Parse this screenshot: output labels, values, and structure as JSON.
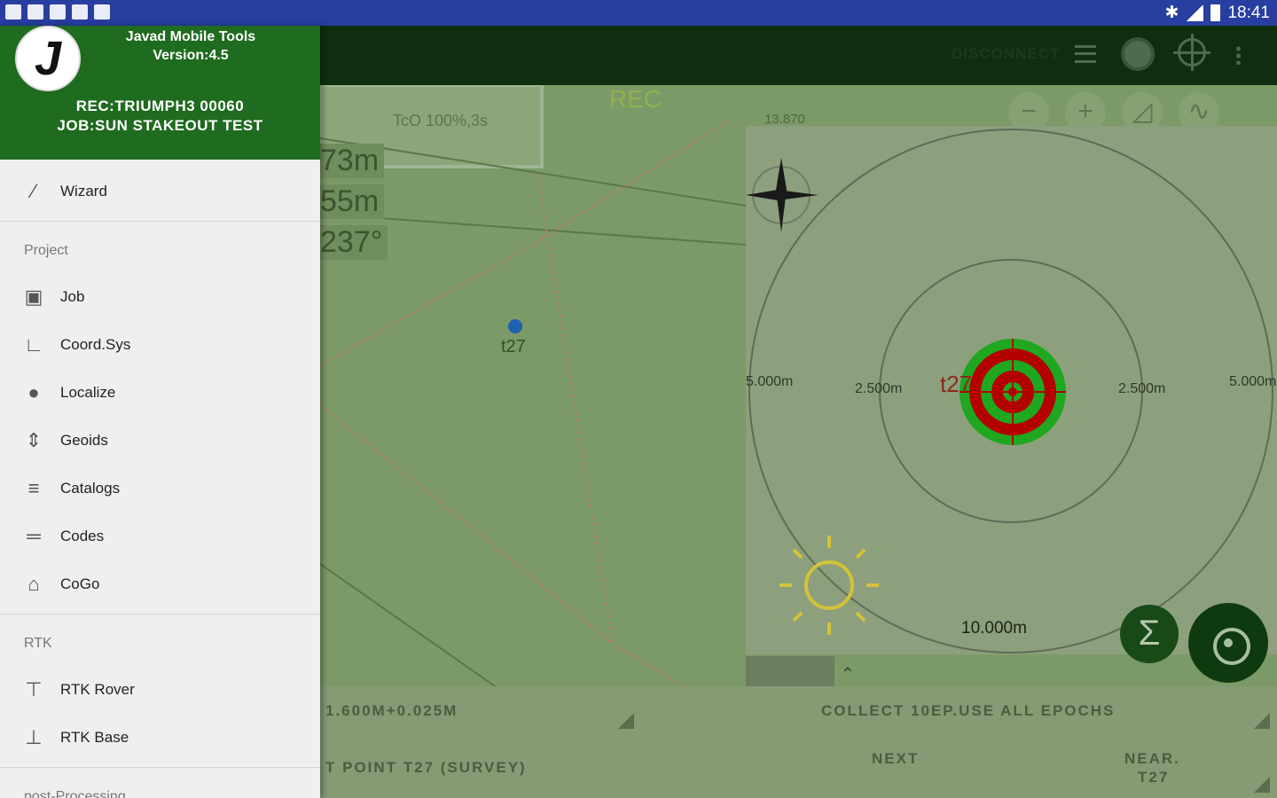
{
  "statusbar": {
    "time": "18:41"
  },
  "toolbar": {
    "disconnect_label": "DISCONNECT"
  },
  "drawer": {
    "app_name": "Javad Mobile Tools",
    "version": "Version:4.5",
    "receiver": "REC:TRIUMPH3 00060",
    "job": "JOB:SUN STAKEOUT TEST",
    "logo_text": "J",
    "wizard": "Wizard",
    "sections": {
      "project": "Project",
      "rtk": "RTK",
      "post": "post-Processing"
    },
    "project_items": [
      "Job",
      "Coord.Sys",
      "Localize",
      "Geoids",
      "Catalogs",
      "Codes",
      "CoGo"
    ],
    "rtk_items": [
      "RTK Rover",
      "RTK Base"
    ]
  },
  "map": {
    "gnss": "TcO 100%,3s",
    "rec": "REC",
    "coord": "13.870",
    "dist1": "73m",
    "dist2": "55m",
    "angle": "237°",
    "point": "t27"
  },
  "bullseye": {
    "ring_outer_left": "5.000m",
    "ring_inner_left": "2.500m",
    "ring_inner_right": "2.500m",
    "ring_outer_right": "5.000m",
    "scale": "10.000m",
    "point_label": "t27"
  },
  "bottom": {
    "height": "1.600M+0.025M",
    "collect": "COLLECT 10EP.USE ALL EPOCHS",
    "stake_point": "T POINT  T27 (SURVEY)",
    "next": "NEXT",
    "near_1": "NEAR.",
    "near_2": "T27"
  },
  "colors": {
    "statusbar": "#283ea0",
    "drawer_header": "#1f6b1f",
    "target_green": "#1fa81f",
    "target_red": "#b30000"
  }
}
